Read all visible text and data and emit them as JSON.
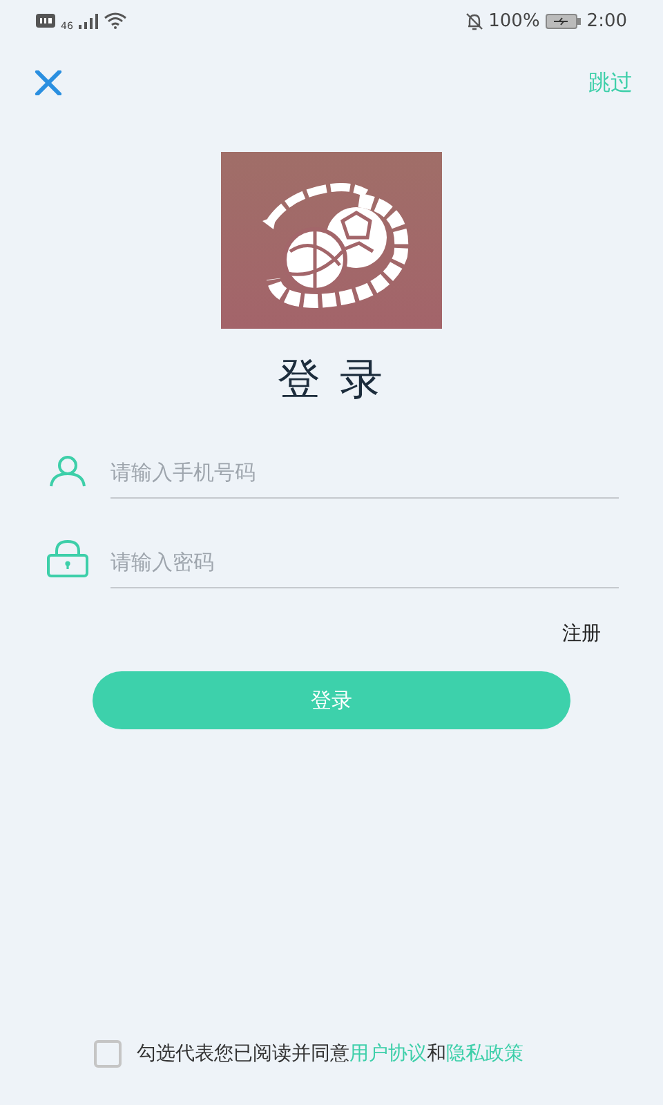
{
  "status_bar": {
    "network": "46",
    "battery_percent": "100%",
    "time": "2:00"
  },
  "skip": "跳过",
  "title": "登 录",
  "fields": [
    {
      "kind": "user",
      "placeholder": "请输入手机号码"
    },
    {
      "kind": "lock",
      "placeholder": "请输入密码"
    }
  ],
  "register": "注册",
  "login_button": "登录",
  "agreement": {
    "checked": false,
    "parts": [
      {
        "kind": "text",
        "text": "勾选代表您已阅读并同意"
      },
      {
        "kind": "link",
        "text": "用户协议"
      },
      {
        "kind": "text",
        "text": "和"
      },
      {
        "kind": "link",
        "text": "隐私政策"
      }
    ]
  }
}
